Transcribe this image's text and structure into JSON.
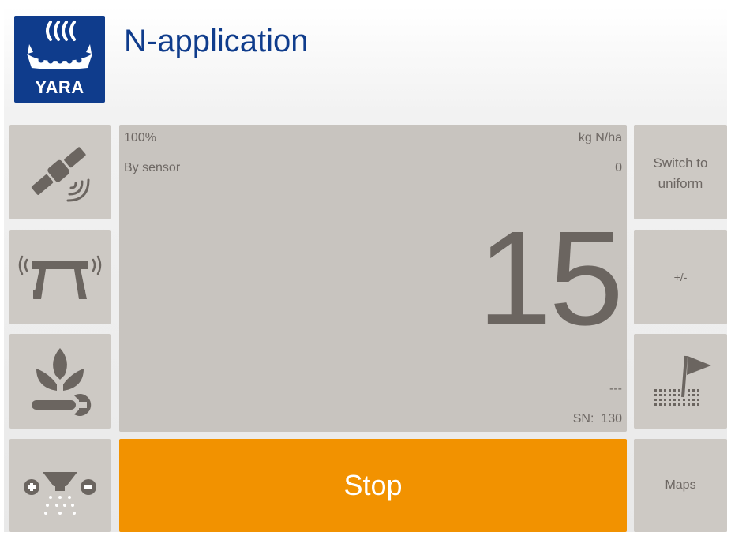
{
  "header": {
    "logo_text": "YARA",
    "title": "N-application"
  },
  "display": {
    "percent": "100%",
    "unit": "kg N/ha",
    "mode": "By sensor",
    "small_value": "0",
    "main_value": "15",
    "dash": "---",
    "sn_label": "SN:",
    "sn_value": "130"
  },
  "left_buttons": [
    {
      "icon": "satellite-gps-icon"
    },
    {
      "icon": "sensor-boom-icon"
    },
    {
      "icon": "crop-settings-icon"
    },
    {
      "icon": "spreader-rate-icon"
    }
  ],
  "right_buttons": {
    "switch_line1": "Switch to",
    "switch_line2": "uniform",
    "plus_minus": "+/-",
    "flag_icon": "field-flag-icon",
    "maps": "Maps"
  },
  "actions": {
    "stop": "Stop"
  },
  "colors": {
    "brand": "#0f3c8c",
    "stop": "#f29200",
    "panel": "#cdc9c4",
    "icon": "#6b6560"
  }
}
